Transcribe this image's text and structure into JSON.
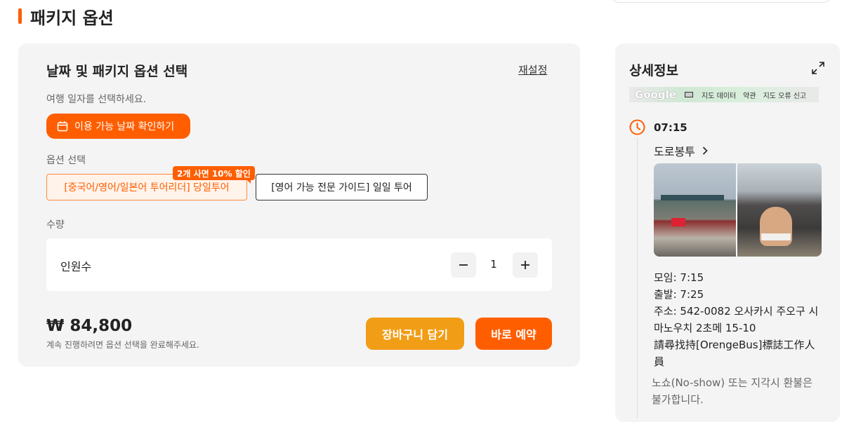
{
  "section": {
    "title": "패키지 옵션"
  },
  "panel": {
    "title": "날짜 및 패키지 옵션 선택",
    "reset_label": "재설정",
    "date_prompt": "여행 일자를 선택하세요.",
    "date_button": "이용 가능 날짜 확인하기",
    "option_label": "옵션 선택",
    "options": [
      {
        "label": "[중국어/영어/일본어 투어리더] 당일투어",
        "selected": true
      },
      {
        "label": "[영어 가능 전문 가이드] 일일 투어",
        "selected": false
      }
    ],
    "discount_badge": "2개 사면 10% 할인",
    "quantity_label": "수량",
    "quantity": {
      "label": "인원수",
      "value": "1"
    },
    "price": "₩ 84,800",
    "price_note": "계속 진행하려면 옵션 선택을 완료해주세요.",
    "cart_button": "장바구니 담기",
    "book_button": "바로 예약"
  },
  "side": {
    "title": "상세정보",
    "map": {
      "logo": "Google",
      "items": [
        "지도 데이터",
        "약관",
        "지도 오류 신고"
      ]
    },
    "time": "07:15",
    "place": "도로봉투",
    "info_lines": [
      "모임: 7:15",
      "출발: 7:25",
      "주소: 542-0082 오사카시 주오구 시마노우치 2초메 15-10",
      "請尋找持[OrengeBus]標誌工作人員"
    ],
    "note": "노쇼(No-show) 또는 지각시 환불은 불가합니다."
  },
  "colors": {
    "accent": "#ff5e00",
    "cart": "#f29d16",
    "panel_bg": "#f4f4f4"
  }
}
